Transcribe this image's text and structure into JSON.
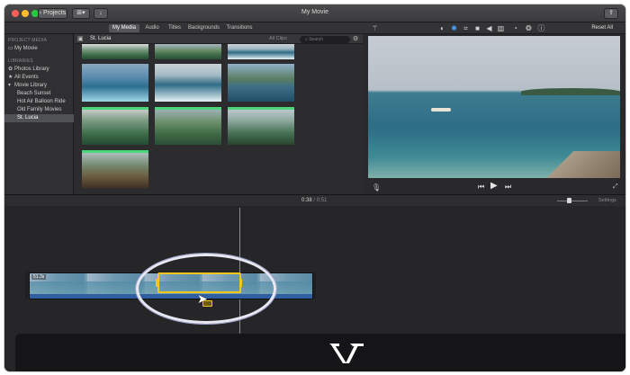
{
  "window": {
    "title": "My Movie"
  },
  "titlebar": {
    "projects_label": "Projects",
    "view_label": "⊞▾",
    "import_label": "↓",
    "share_label": "⇪"
  },
  "toolbar": {
    "tabs": [
      {
        "label": "My Media",
        "active": true
      },
      {
        "label": "Audio",
        "active": false
      },
      {
        "label": "Titles",
        "active": false
      },
      {
        "label": "Backgrounds",
        "active": false
      },
      {
        "label": "Transitions",
        "active": false
      }
    ],
    "icons": [
      "magic-wand-icon",
      "color-balance-icon",
      "color-correction-icon",
      "crop-icon",
      "stabilization-icon",
      "volume-icon",
      "noise-reduction-icon",
      "speed-icon",
      "filter-icon",
      "info-icon"
    ],
    "reset_all": "Reset All"
  },
  "sidebar": {
    "project_media_heading": "PROJECT MEDIA",
    "project": "My Movie",
    "libraries_heading": "LIBRARIES",
    "photos_library": "Photos Library",
    "all_events": "All Events",
    "movie_library": "Movie Library",
    "events": [
      "Beach Sunset",
      "Hot Air Balloon Ride",
      "Old Family Movies",
      "St. Lucia"
    ],
    "selected_event": "St. Lucia"
  },
  "browser": {
    "title": "St. Lucia",
    "filter": "All Clips",
    "search_placeholder": "Search"
  },
  "timeline": {
    "current_time": "0:38",
    "separator": " / ",
    "total_time": "0:51",
    "settings_label": "Settings",
    "clip_duration": "51.3s"
  },
  "colors": {
    "accent_selection": "#f3c61a",
    "accent_active": "#4ea3ff",
    "added_indicator": "#4cd67a"
  }
}
